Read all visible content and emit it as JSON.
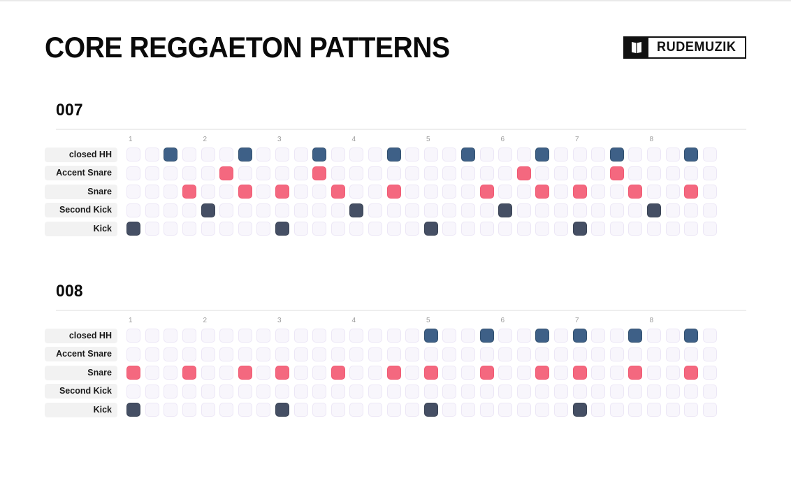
{
  "header": {
    "title": "CORE REGGAETON PATTERNS",
    "logo_word": "RUDEMUZIK",
    "logo_icon": "open-book-icon"
  },
  "colors": {
    "hh": "#3e6087",
    "snare": "#f4687f",
    "accent": "#f4687f",
    "kick": "#454f64",
    "kick2": "#454f64",
    "empty": "#f8f6fc",
    "empty_border": "#ece7f6",
    "label_pill": "#f2f2f2",
    "rule": "#eeeeee",
    "beat_number": "#9b9b9b",
    "title": "#0a0a0a"
  },
  "grid": {
    "steps_total": 32,
    "steps_per_beat": 4,
    "beat_labels": [
      "1",
      "2",
      "3",
      "4",
      "5",
      "6",
      "7",
      "8"
    ],
    "row_labels": [
      "closed HH",
      "Accent Snare",
      "Snare",
      "Second Kick",
      "Kick"
    ],
    "row_kinds": [
      "hh",
      "accent",
      "snare",
      "kick2",
      "kick"
    ]
  },
  "patterns": [
    {
      "id": "007",
      "label": "007",
      "rows": [
        {
          "name": "closed HH",
          "kind": "hh",
          "steps": [
            0,
            0,
            1,
            0,
            0,
            0,
            1,
            0,
            0,
            0,
            1,
            0,
            0,
            0,
            1,
            0,
            0,
            0,
            1,
            0,
            0,
            0,
            1,
            0,
            0,
            0,
            1,
            0,
            0,
            0,
            1,
            0
          ]
        },
        {
          "name": "Accent Snare",
          "kind": "accent",
          "steps": [
            0,
            0,
            0,
            0,
            0,
            1,
            0,
            0,
            0,
            0,
            1,
            0,
            0,
            0,
            0,
            0,
            0,
            0,
            0,
            0,
            0,
            1,
            0,
            0,
            0,
            0,
            1,
            0,
            0,
            0,
            0,
            0
          ]
        },
        {
          "name": "Snare",
          "kind": "snare",
          "steps": [
            0,
            0,
            0,
            1,
            0,
            0,
            1,
            0,
            1,
            0,
            0,
            1,
            0,
            0,
            1,
            0,
            0,
            0,
            0,
            1,
            0,
            0,
            1,
            0,
            1,
            0,
            0,
            1,
            0,
            0,
            1,
            0
          ]
        },
        {
          "name": "Second Kick",
          "kind": "kick2",
          "steps": [
            0,
            0,
            0,
            0,
            1,
            0,
            0,
            0,
            0,
            0,
            0,
            0,
            1,
            0,
            0,
            0,
            0,
            0,
            0,
            0,
            1,
            0,
            0,
            0,
            0,
            0,
            0,
            0,
            1,
            0,
            0,
            0
          ]
        },
        {
          "name": "Kick",
          "kind": "kick",
          "steps": [
            1,
            0,
            0,
            0,
            0,
            0,
            0,
            0,
            1,
            0,
            0,
            0,
            0,
            0,
            0,
            0,
            1,
            0,
            0,
            0,
            0,
            0,
            0,
            0,
            1,
            0,
            0,
            0,
            0,
            0,
            0,
            0
          ]
        }
      ]
    },
    {
      "id": "008",
      "label": "008",
      "rows": [
        {
          "name": "closed HH",
          "kind": "hh",
          "steps": [
            0,
            0,
            0,
            0,
            0,
            0,
            0,
            0,
            0,
            0,
            0,
            0,
            0,
            0,
            0,
            0,
            1,
            0,
            0,
            1,
            0,
            0,
            1,
            0,
            1,
            0,
            0,
            1,
            0,
            0,
            1,
            0
          ]
        },
        {
          "name": "Accent Snare",
          "kind": "accent",
          "steps": [
            0,
            0,
            0,
            0,
            0,
            0,
            0,
            0,
            0,
            0,
            0,
            0,
            0,
            0,
            0,
            0,
            0,
            0,
            0,
            0,
            0,
            0,
            0,
            0,
            0,
            0,
            0,
            0,
            0,
            0,
            0,
            0
          ]
        },
        {
          "name": "Snare",
          "kind": "snare",
          "steps": [
            1,
            0,
            0,
            1,
            0,
            0,
            1,
            0,
            1,
            0,
            0,
            1,
            0,
            0,
            1,
            0,
            1,
            0,
            0,
            1,
            0,
            0,
            1,
            0,
            1,
            0,
            0,
            1,
            0,
            0,
            1,
            0
          ]
        },
        {
          "name": "Second Kick",
          "kind": "kick2",
          "steps": [
            0,
            0,
            0,
            0,
            0,
            0,
            0,
            0,
            0,
            0,
            0,
            0,
            0,
            0,
            0,
            0,
            0,
            0,
            0,
            0,
            0,
            0,
            0,
            0,
            0,
            0,
            0,
            0,
            0,
            0,
            0,
            0
          ]
        },
        {
          "name": "Kick",
          "kind": "kick",
          "steps": [
            1,
            0,
            0,
            0,
            0,
            0,
            0,
            0,
            1,
            0,
            0,
            0,
            0,
            0,
            0,
            0,
            1,
            0,
            0,
            0,
            0,
            0,
            0,
            0,
            1,
            0,
            0,
            0,
            0,
            0,
            0,
            0
          ]
        }
      ]
    }
  ]
}
